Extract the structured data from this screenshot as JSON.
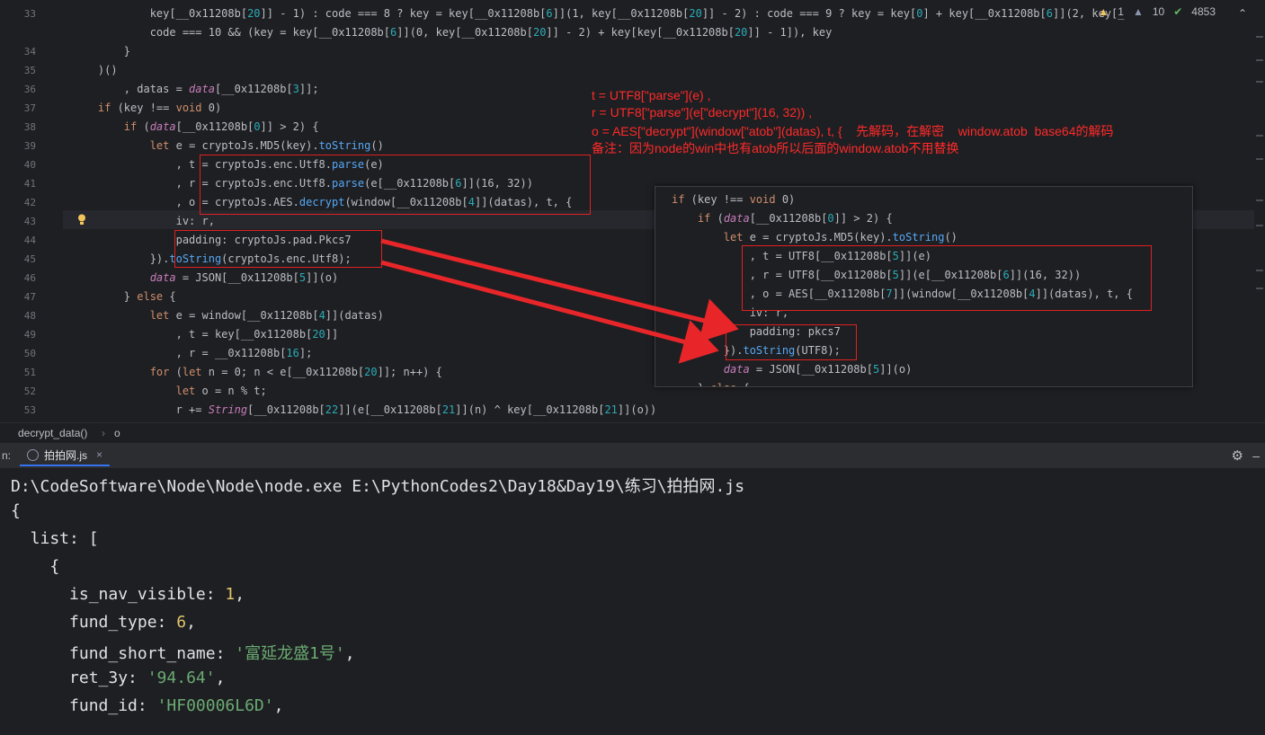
{
  "editor": {
    "status": {
      "warnings": "1",
      "weak_warnings": "10",
      "ok": "4853"
    },
    "lines": [
      {
        "n": "33",
        "text": "            key[__0x11208b[20]] - 1) : code === 8 ? key = key[__0x11208b[6]](1, key[__0x11208b[20]] - 2) : code === 9 ? key = key[0] + key[__0x11208b[6]](2, key[_"
      },
      {
        "n": "",
        "text": "            code === 10 && (key = key[__0x11208b[6]](0, key[__0x11208b[20]] - 2) + key[key[__0x11208b[20]] - 1]), key"
      },
      {
        "n": "34",
        "text": "        }"
      },
      {
        "n": "35",
        "text": "    )()"
      },
      {
        "n": "36",
        "text": "        , datas = data[__0x11208b[3]];"
      },
      {
        "n": "37",
        "text": "    if (key !== void 0)"
      },
      {
        "n": "38",
        "text": "        if (data[__0x11208b[0]] > 2) {"
      },
      {
        "n": "39",
        "text": "            let e = cryptoJs.MD5(key).toString()"
      },
      {
        "n": "40",
        "text": "                , t = cryptoJs.enc.Utf8.parse(e)"
      },
      {
        "n": "41",
        "text": "                , r = cryptoJs.enc.Utf8.parse(e[__0x11208b[6]](16, 32))"
      },
      {
        "n": "42",
        "text": "                , o = cryptoJs.AES.decrypt(window[__0x11208b[4]](datas), t, {"
      },
      {
        "n": "43",
        "text": "                iv: r,"
      },
      {
        "n": "44",
        "text": "                padding: cryptoJs.pad.Pkcs7"
      },
      {
        "n": "45",
        "text": "            }).toString(cryptoJs.enc.Utf8);"
      },
      {
        "n": "46",
        "text": "            data = JSON[__0x11208b[5]](o)"
      },
      {
        "n": "47",
        "text": "        } else {"
      },
      {
        "n": "48",
        "text": "            let e = window[__0x11208b[4]](datas)"
      },
      {
        "n": "49",
        "text": "                , t = key[__0x11208b[20]]"
      },
      {
        "n": "50",
        "text": "                , r = __0x11208b[16];"
      },
      {
        "n": "51",
        "text": "            for (let n = 0; n < e[__0x11208b[20]]; n++) {"
      },
      {
        "n": "52",
        "text": "                let o = n % t;"
      },
      {
        "n": "53",
        "text": "                r += String[__0x11208b[22]](e[__0x11208b[21]](n) ^ key[__0x11208b[21]](o))"
      }
    ]
  },
  "annotation": {
    "line1": "t = UTF8[\"parse\"](e) ,",
    "line2": "r = UTF8[\"parse\"](e[\"decrypt\"](16, 32)) ,",
    "line3": "o = AES[\"decrypt\"](window[\"atob\"](datas), t, {    先解码，在解密    window.atob  base64的解码",
    "line4": "备注：因为node的win中也有atob所以后面的window.atob不用替换"
  },
  "popup": {
    "lines": [
      "if (key !== void 0)",
      "    if (data[__0x11208b[0]] > 2) {",
      "        let e = cryptoJs.MD5(key).toString()",
      "            , t = UTF8[__0x11208b[5]](e)",
      "            , r = UTF8[__0x11208b[5]](e[__0x11208b[6]](16, 32))",
      "            , o = AES[__0x11208b[7]](window[__0x11208b[4]](datas), t, {",
      "            iv: r,",
      "            padding: pkcs7",
      "        }).toString(UTF8);",
      "        data = JSON[__0x11208b[5]](o)",
      "    } else {"
    ]
  },
  "breadcrumb": {
    "func": "decrypt_data()",
    "sep": "›",
    "var": "o"
  },
  "run_tab": {
    "prefix": "n:",
    "file": "拍拍网.js"
  },
  "console": {
    "command": "D:\\CodeSoftware\\Node\\Node\\node.exe E:\\PythonCodes2\\Day18&Day19\\练习\\拍拍网.js",
    "open_brace": "{",
    "list_key": "  list: [",
    "item_open": "    {",
    "fields": [
      {
        "key": "is_nav_visible",
        "value": "1",
        "kind": "num"
      },
      {
        "key": "fund_type",
        "value": "6",
        "kind": "num"
      },
      {
        "key": "fund_short_name",
        "value": "'富延龙盛1号'",
        "kind": "str"
      },
      {
        "key": "ret_3y",
        "value": "'94.64'",
        "kind": "str"
      },
      {
        "key": "fund_id",
        "value": "'HF00006L6D'",
        "kind": "str"
      }
    ]
  }
}
